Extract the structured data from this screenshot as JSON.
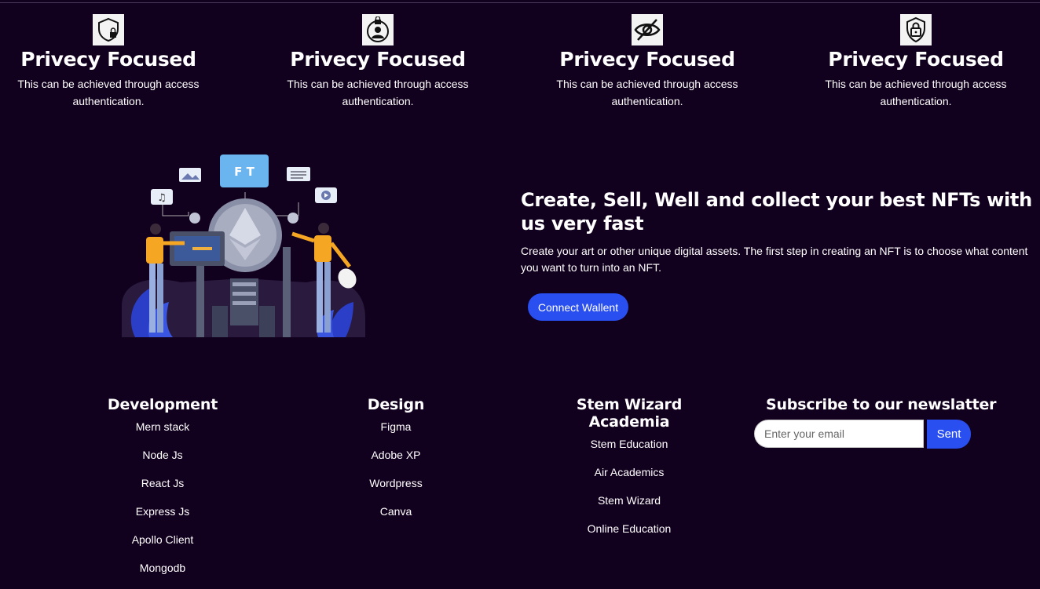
{
  "features": [
    {
      "icon": "shield-lock-icon",
      "title": "Privecy Focused",
      "text": "This can be achieved through access authentication."
    },
    {
      "icon": "user-lock-icon",
      "title": "Privecy Focused",
      "text": "This can be achieved through access authentication."
    },
    {
      "icon": "eye-off-icon",
      "title": "Privecy Focused",
      "text": "This can be achieved through access authentication."
    },
    {
      "icon": "shield-padlock-icon",
      "title": "Privecy Focused",
      "text": "This can be achieved through access authentication."
    }
  ],
  "hero": {
    "title": "Create, Sell, Well and collect your best NFTs with us very fast",
    "text": "Create your art or other unique digital assets. The first step in creating an NFT is to choose what content you want to turn into an NFT.",
    "button": "Connect Wallent",
    "illustration_badge": "F T"
  },
  "footer": {
    "development": {
      "title": "Development",
      "items": [
        "Mern stack",
        "Node Js",
        "React Js",
        "Express Js",
        "Apollo Client",
        "Mongodb"
      ]
    },
    "design": {
      "title": "Design",
      "items": [
        "Figma",
        "Adobe XP",
        "Wordpress",
        "Canva"
      ]
    },
    "academia": {
      "title": "Stem Wizard Academia",
      "items": [
        "Stem Education",
        "Air Academics",
        "Stem Wizard",
        "Online Education"
      ]
    },
    "newsletter": {
      "title": "Subscribe to our newslatter",
      "placeholder": "Enter your email",
      "button": "Sent"
    }
  },
  "colors": {
    "background": "#12011e",
    "accent": "#2a4ff0"
  }
}
